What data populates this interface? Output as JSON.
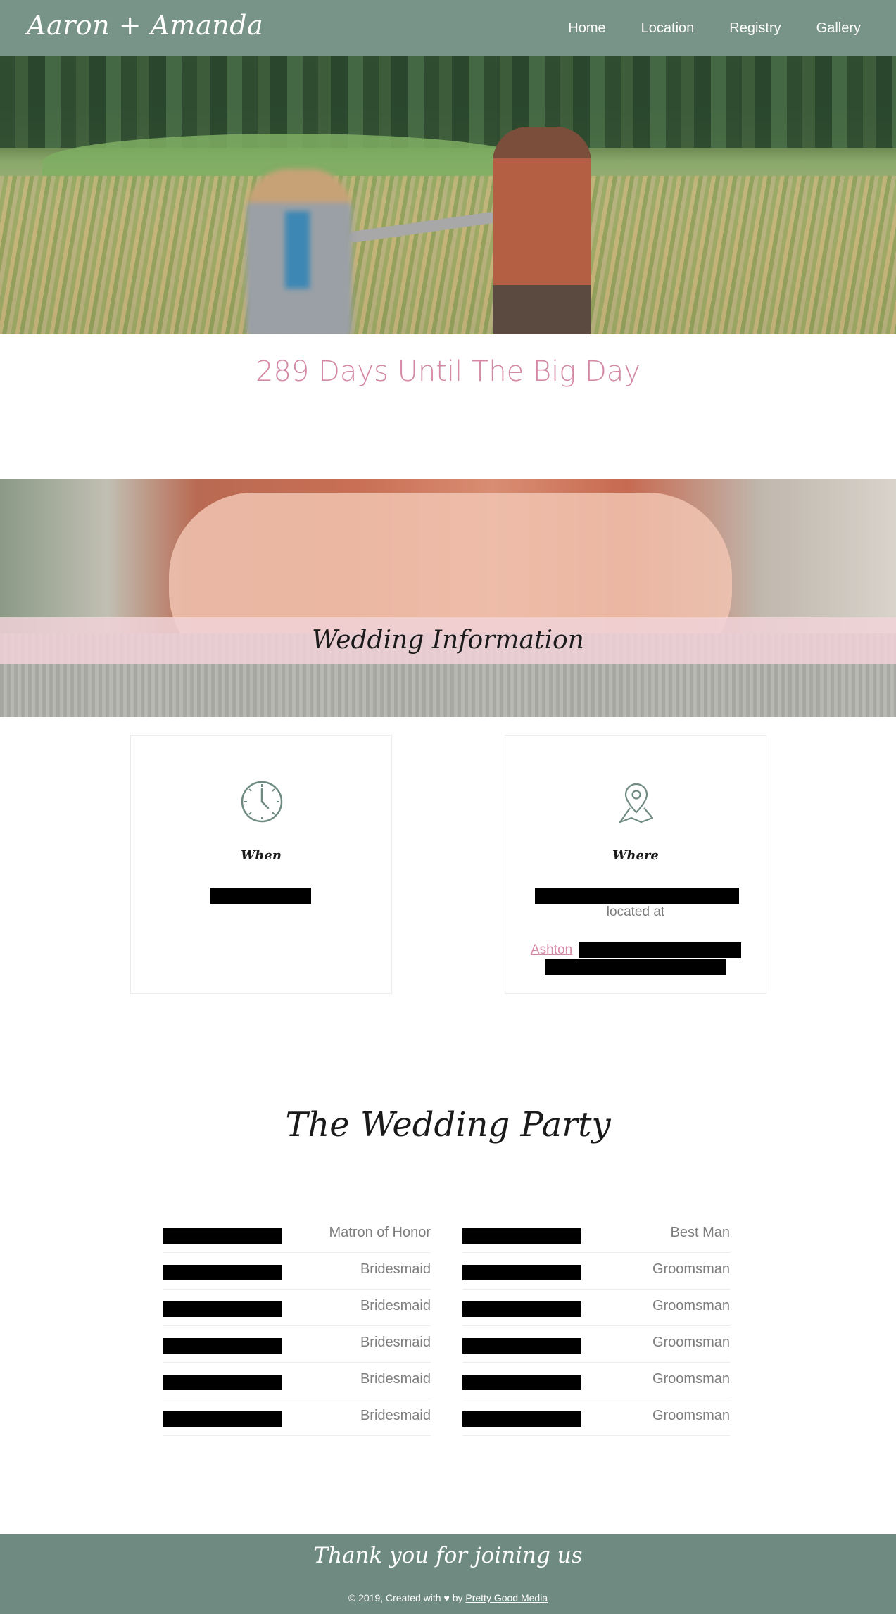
{
  "header": {
    "brand": "Aaron + Amanda",
    "nav": [
      "Home",
      "Location",
      "Registry",
      "Gallery"
    ]
  },
  "countdown": "289 Days Until The Big Day",
  "info": {
    "title": "Wedding Information",
    "when": {
      "heading": "When",
      "icon": "clock-icon"
    },
    "where": {
      "heading": "Where",
      "icon": "map-pin-icon",
      "located_at": "located at",
      "venue_link": "Ashton"
    }
  },
  "party": {
    "title": "The Wedding Party",
    "bride_side": [
      "Matron of Honor",
      "Bridesmaid",
      "Bridesmaid",
      "Bridesmaid",
      "Bridesmaid",
      "Bridesmaid"
    ],
    "groom_side": [
      "Best Man",
      "Groomsman",
      "Groomsman",
      "Groomsman",
      "Groomsman",
      "Groomsman"
    ]
  },
  "footer": {
    "thanks": "Thank you for joining us",
    "copyright": "© 2019, Created with ♥ by",
    "credit_link": "Pretty Good Media"
  },
  "colors": {
    "header_bg": "#789388",
    "footer_bg": "#6f8a80",
    "accent_pink": "#d48aa6",
    "band_pink": "#f1d2d8"
  }
}
